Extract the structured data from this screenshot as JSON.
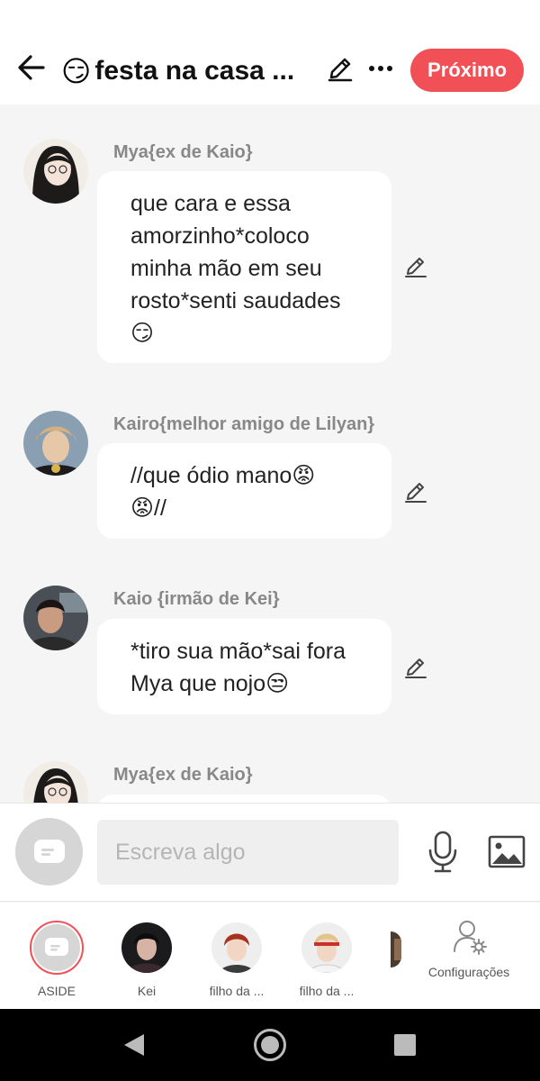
{
  "header": {
    "title_emoji": "😏",
    "title": "festa na casa ...",
    "next_label": "Próximo",
    "accent_color": "#f25057"
  },
  "messages": [
    {
      "sender": "Mya{ex de Kaio}",
      "lines": [
        "que cara e essa",
        "amorzinho*coloco",
        "minha mão em seu",
        "rosto*senti saudades",
        "😏"
      ]
    },
    {
      "sender": "Kairo{melhor amigo de Lilyan}",
      "lines": [
        "//que ódio mano😡",
        "😡//"
      ]
    },
    {
      "sender": "Kaio {irmão de Kei}",
      "lines": [
        "*tiro sua mão*sai fora",
        "Mya que nojo😒"
      ]
    },
    {
      "sender": "Mya{ex de Kaio}",
      "lines": []
    }
  ],
  "input": {
    "placeholder": "Escreva algo",
    "value": ""
  },
  "cast": [
    {
      "label": "ASIDE"
    },
    {
      "label": "Kei"
    },
    {
      "label": "filho da ..."
    },
    {
      "label": "filho da ..."
    }
  ],
  "settings": {
    "label": "Configurações"
  },
  "icons": {
    "back": "arrow-left-icon",
    "edit": "pencil-icon",
    "more": "more-horizontal-icon",
    "mic": "microphone-icon",
    "image": "image-icon",
    "settings": "user-gear-icon"
  }
}
